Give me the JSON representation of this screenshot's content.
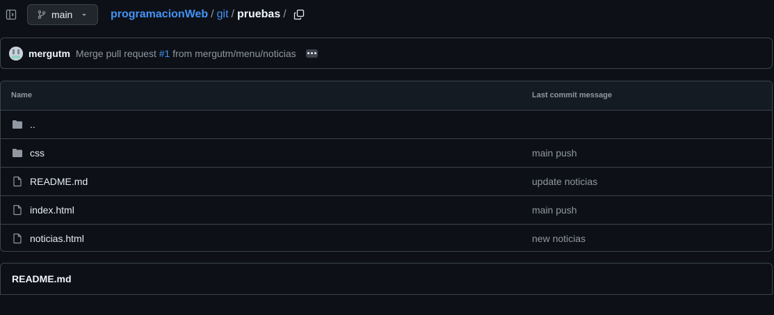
{
  "branch": {
    "name": "main"
  },
  "breadcrumb": {
    "repo": "programacionWeb",
    "sep1": "/",
    "folder": "git",
    "sep2": "/",
    "current": "pruebas",
    "sep3": "/"
  },
  "commit": {
    "author": "mergutm",
    "message_prefix": "Merge pull request",
    "pr_number": "#1",
    "message_suffix": "from mergutm/menu/noticias"
  },
  "table": {
    "columns": {
      "name": "Name",
      "message": "Last commit message"
    },
    "rows": [
      {
        "name": "..",
        "message": "",
        "icon": "folder-icon"
      },
      {
        "name": "css",
        "message": "main push",
        "icon": "folder-icon"
      },
      {
        "name": "README.md",
        "message": "update noticias",
        "icon": "file-icon"
      },
      {
        "name": "index.html",
        "message": "main push",
        "icon": "file-icon"
      },
      {
        "name": "noticias.html",
        "message": "new noticias",
        "icon": "file-icon"
      }
    ]
  },
  "readme": {
    "title": "README.md"
  },
  "colors": {
    "background": "#0d1117",
    "link": "#4493f8",
    "muted": "#9198a1",
    "border": "#3d444d"
  }
}
